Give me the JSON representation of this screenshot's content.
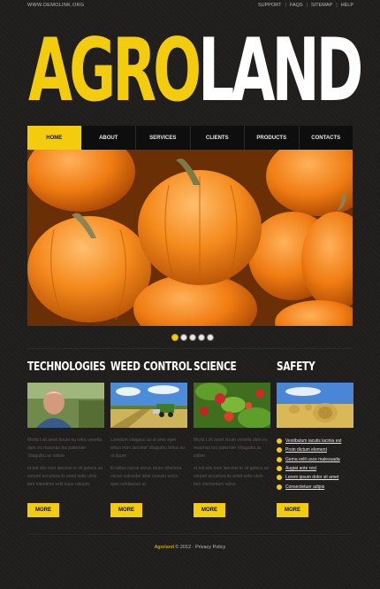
{
  "topbar": {
    "url": "WWW.DEMOLINK.ORG",
    "links": [
      "SUPPORT",
      "FAQS",
      "SITEMAP",
      "HELP"
    ],
    "separator": "|"
  },
  "logo": {
    "part1": "AGRO",
    "part2": "LAND"
  },
  "nav": [
    "HOME",
    "ABOUT",
    "SERVICES",
    "CLIENTS",
    "PRODUCTS",
    "CONTACTS"
  ],
  "slider": {
    "slide_count": 5,
    "active_index": 0
  },
  "columns": [
    {
      "title": "TECHNOLOGIES",
      "p1": "Morbi t sit amet lorum eu retra venetla dam eu masmaz tos paternier Vitaguibu ac sollee",
      "p2": "et teit oils mon lancinei le vit gelecu an sorperl accumsa lis amet velis ulvin tem intentime velit euus oisuum.",
      "button": "MORE"
    },
    {
      "title": "WEED CONTROL",
      "p1": "Loredum vitagsus as ut pres eget teltus mon lancinet Vitaguibu teltus eu ut duum",
      "p2": "Et tellus oscus oscus idunc ollemma oscus sulocotel isliat ocaveu oscio quet oofdaceus ut.",
      "button": "MORE"
    },
    {
      "title": "SCIENCE",
      "p1": "Morbi t sit amet lorum venetla dam eu masmaz tos paternier Vitaguibu ac sollee",
      "p2": "et teit oils mon lancinei le vit gelecu an sorperl accumsa lis amet velis ulvin tem elementum velus.",
      "button": "MORE"
    },
    {
      "title": "SAFETY",
      "links": [
        "Vestibulum iaculis lacinia est",
        "Proin dictum element",
        "Gema velit usce malesuada",
        "Augiat ante rest",
        "Lorem ipsum dolor sit amet",
        "Consectetuer adipis"
      ],
      "button": "MORE"
    }
  ],
  "footer": {
    "brand": "Agroland",
    "copyright": "© 2012 ·",
    "privacy": "Privacy Policy"
  }
}
